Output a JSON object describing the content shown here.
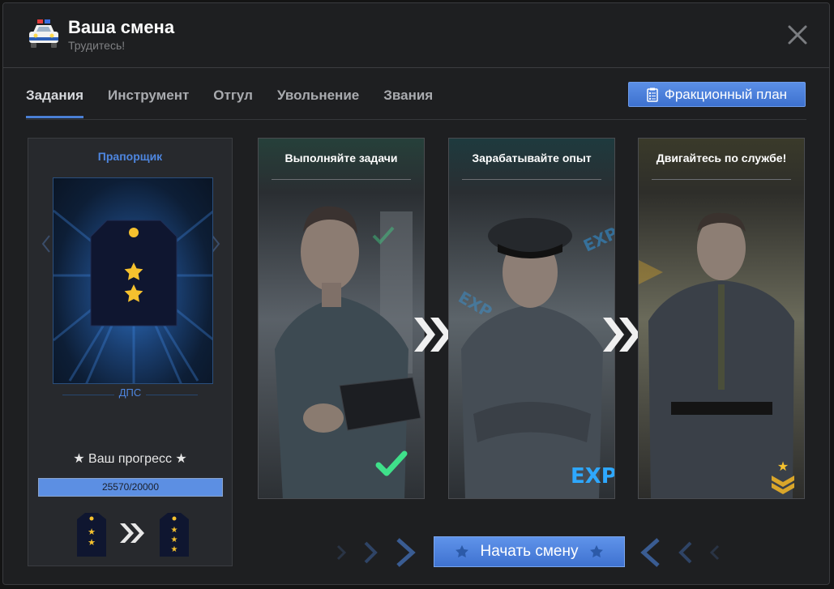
{
  "window": {
    "title": "Ваша смена",
    "subtitle": "Трудитесь!"
  },
  "tabs": [
    {
      "label": "Задания",
      "active": true
    },
    {
      "label": "Инструмент",
      "active": false
    },
    {
      "label": "Отгул",
      "active": false
    },
    {
      "label": "Увольнение",
      "active": false
    },
    {
      "label": "Звания",
      "active": false
    }
  ],
  "plan_button": {
    "label": "Фракционный план",
    "icon": "clipboard-list-icon"
  },
  "rank_panel": {
    "rank_name": "Прапорщик",
    "department": "ДПС",
    "progress_label": "★ Ваш прогресс ★",
    "progress_text": "25570/20000",
    "progress_fraction": 1.0,
    "current_stars": 2,
    "next_stars": 3
  },
  "cards": [
    {
      "title": "Выполняйте задачи",
      "badge": "check-icon"
    },
    {
      "title": "Зарабатывайте опыт",
      "badge": "EXP"
    },
    {
      "title": "Двигайтесь по службе!",
      "badge": "rank-chevron-icon"
    }
  ],
  "start_button": {
    "label": "Начать смену"
  },
  "colors": {
    "accent": "#4a7fd4",
    "button": "#4b7fdc",
    "check": "#3fe08a",
    "exp": "#2ea8ff",
    "gold": "#f5c12e"
  }
}
